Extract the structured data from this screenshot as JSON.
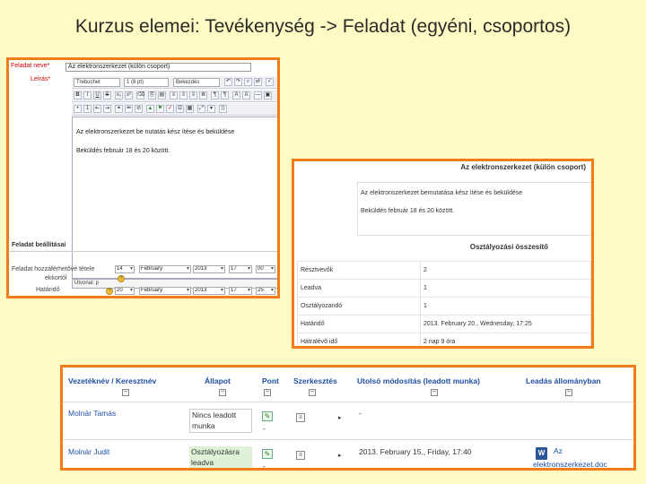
{
  "slide_title": "Kurzus elemei: Tevékenység -> Feladat (egyéni, csoportos)",
  "editor": {
    "name_label": "Feladat neve*",
    "name_value": "Az elektronszerkezet (külön csoport)",
    "desc_label": "Leírás*",
    "font_family": "Trebuchet",
    "font_size": "1 (8 pt)",
    "format": "Bekezdés",
    "body_line1": "Az elektronszerkezet be nutatás kész ítése és beküldése",
    "body_line2": "Beküldés február 18 és 20 között.",
    "path": "Útvonal: p",
    "settings_heading": "Feladat beállításai",
    "avail_label": "Feladat hozzáférhetővé tétele",
    "avail_label2": "ekkortól",
    "due_label": "Határidő",
    "avail_date": {
      "day": "14",
      "month": "February",
      "year": "2013",
      "hour": "17",
      "min": "00"
    },
    "due_date": {
      "day": "20",
      "month": "February",
      "year": "2013",
      "hour": "17",
      "min": "25"
    }
  },
  "summary": {
    "title": "Az elektronszerkezet (külön csoport)",
    "desc_line1": "Az elektronszerkezet bemutatása kész ítése és beküldése",
    "desc_line2": "Beküldés február 18 és 20 között.",
    "subheading": "Osztályozási összesítő",
    "rows": [
      {
        "k": "Résztvevők",
        "v": "2"
      },
      {
        "k": "Leadva",
        "v": "1"
      },
      {
        "k": "Osztályozandó",
        "v": "1"
      },
      {
        "k": "Határidő",
        "v": "2013. February 20., Wednesday, 17:25"
      },
      {
        "k": "Hátralévő idő",
        "v": "2 nap 9 óra"
      }
    ]
  },
  "grading": {
    "headers": {
      "name": "Vezetéknév / Keresztnév",
      "status": "Állapot",
      "grade": "Pont",
      "edit": "Szerkesztés",
      "modified": "Utolsó módosítás (leadott munka)",
      "file": "Leadás állományban"
    },
    "rows": [
      {
        "name": "Molnár Tamás",
        "status_line1": "Nincs leadott",
        "status_line2": "munka",
        "grade": "-",
        "modified": "-",
        "file": ""
      },
      {
        "name": "Molnár Judit",
        "status_line1": "Osztályozásra",
        "status_line2": "leadva",
        "grade": "-",
        "modified": "2013. February 15., Friday, 17:40",
        "file_line1": "Az",
        "file_line2": "elektronszerkezet.doc"
      }
    ],
    "colors": {
      "header": "#1f4fa3",
      "submitted_bg": "#dff2d8",
      "nosubmit_bg": "#ffffff"
    }
  },
  "colors": {
    "slide_bg": "#fefcc4",
    "frame_border": "#f07d18"
  }
}
